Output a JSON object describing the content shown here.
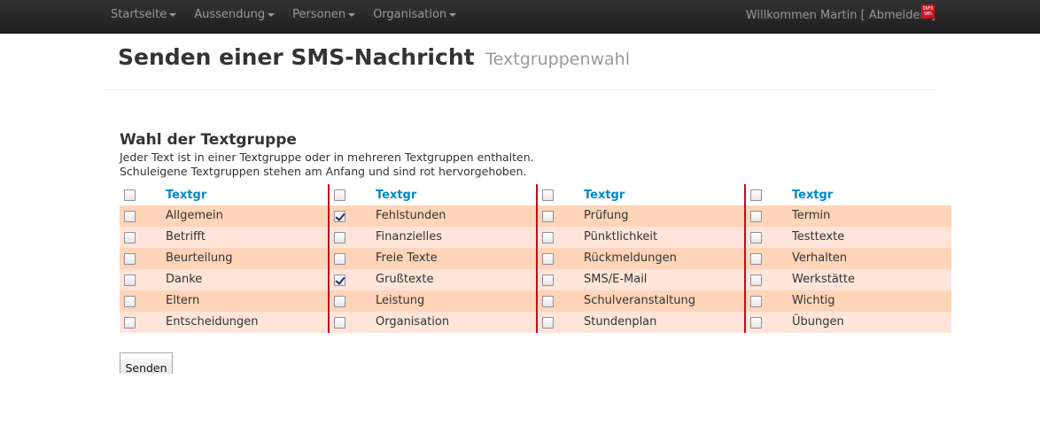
{
  "nav": {
    "items": [
      {
        "label": "Startseite"
      },
      {
        "label": "Aussendung"
      },
      {
        "label": "Personen"
      },
      {
        "label": "Organisation"
      }
    ],
    "welcome": "Willkommen Martin [",
    "logout": "Abmelden",
    "welcome_end": "]",
    "logo_text": "INFO SMS"
  },
  "header": {
    "title": "Senden einer SMS-Nachricht",
    "subtitle": "Textgruppenwahl"
  },
  "section": {
    "title": "Wahl der Textgruppe",
    "line1": "Jeder Text ist in einer Textgruppe oder in mehreren Textgruppen enthalten.",
    "line2": "Schuleigene Textgruppen stehen am Anfang und sind rot hervorgehoben."
  },
  "table": {
    "header_label": "Textgr",
    "columns": [
      {
        "items": [
          {
            "label": "Allgemein",
            "checked": false
          },
          {
            "label": "Betrifft",
            "checked": false
          },
          {
            "label": "Beurteilung",
            "checked": false
          },
          {
            "label": "Danke",
            "checked": false
          },
          {
            "label": "Eltern",
            "checked": false
          },
          {
            "label": "Entscheidungen",
            "checked": false
          }
        ]
      },
      {
        "items": [
          {
            "label": "Fehlstunden",
            "checked": true
          },
          {
            "label": "Finanzielles",
            "checked": false
          },
          {
            "label": "Freie Texte",
            "checked": false
          },
          {
            "label": "Grußtexte",
            "checked": true
          },
          {
            "label": "Leistung",
            "checked": false
          },
          {
            "label": "Organisation",
            "checked": false
          }
        ]
      },
      {
        "items": [
          {
            "label": "Prüfung",
            "checked": false
          },
          {
            "label": "Pünktlichkeit",
            "checked": false
          },
          {
            "label": "Rückmeldungen",
            "checked": false
          },
          {
            "label": "SMS/E-Mail",
            "checked": false
          },
          {
            "label": "Schulveranstaltung",
            "checked": false
          },
          {
            "label": "Stundenplan",
            "checked": false
          }
        ]
      },
      {
        "items": [
          {
            "label": "Termin",
            "checked": false
          },
          {
            "label": "Testtexte",
            "checked": false
          },
          {
            "label": "Verhalten",
            "checked": false
          },
          {
            "label": "Werkstätte",
            "checked": false
          },
          {
            "label": "Wichtig",
            "checked": false
          },
          {
            "label": "Übungen",
            "checked": false
          }
        ]
      }
    ]
  },
  "actions": {
    "send_label": "Senden"
  },
  "colors": {
    "row_odd": "#ffd4b8",
    "row_even": "#ffe5d9",
    "divider": "#b3141b",
    "link": "#0088cc"
  }
}
